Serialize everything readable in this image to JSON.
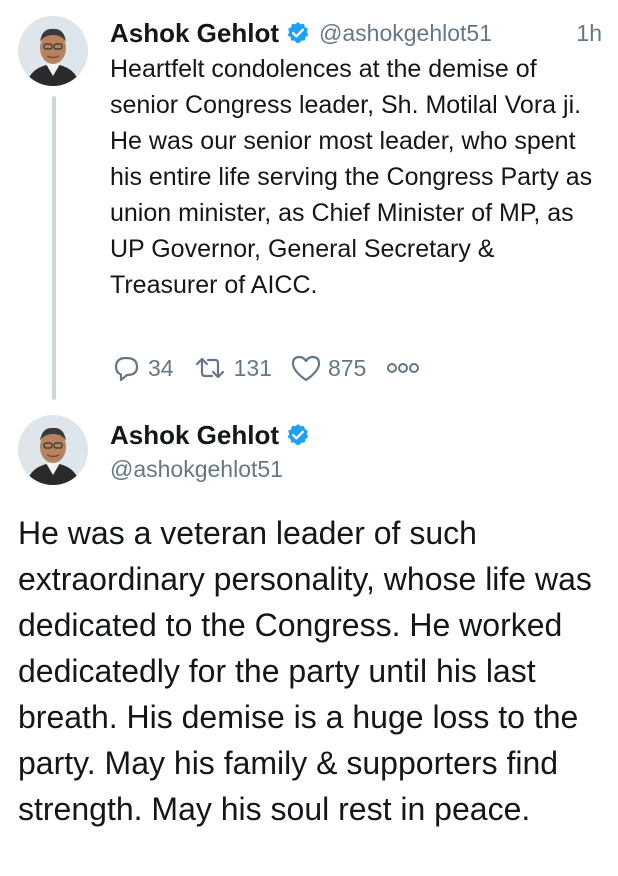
{
  "colors": {
    "verified_blue": "#1da1f2",
    "secondary_text": "#657786",
    "thread_line": "#ccd6dd"
  },
  "tweet1": {
    "author_name": "Ashok Gehlot",
    "handle": "@ashokgehlot51",
    "time": "1h",
    "text": "Heartfelt condolences at the demise of senior Congress leader, Sh. Motilal Vora ji. He was our senior most leader, who spent his entire life serving the Congress Party as union minister, as Chief Minister of MP, as UP Governor, General Secretary & Treasurer of AICC.",
    "replies": "34",
    "retweets": "131",
    "likes": "875",
    "icons": [
      "reply-icon",
      "retweet-icon",
      "like-icon",
      "more-icon",
      "verified-icon"
    ]
  },
  "tweet2": {
    "author_name": "Ashok Gehlot",
    "handle": "@ashokgehlot51",
    "text": "He was a veteran leader of such extraordinary personality, whose life was dedicated to the Congress. He worked dedicatedly for the party until his last breath. His demise is a huge loss to the party. May his family & supporters find strength. May his soul rest in peace."
  }
}
